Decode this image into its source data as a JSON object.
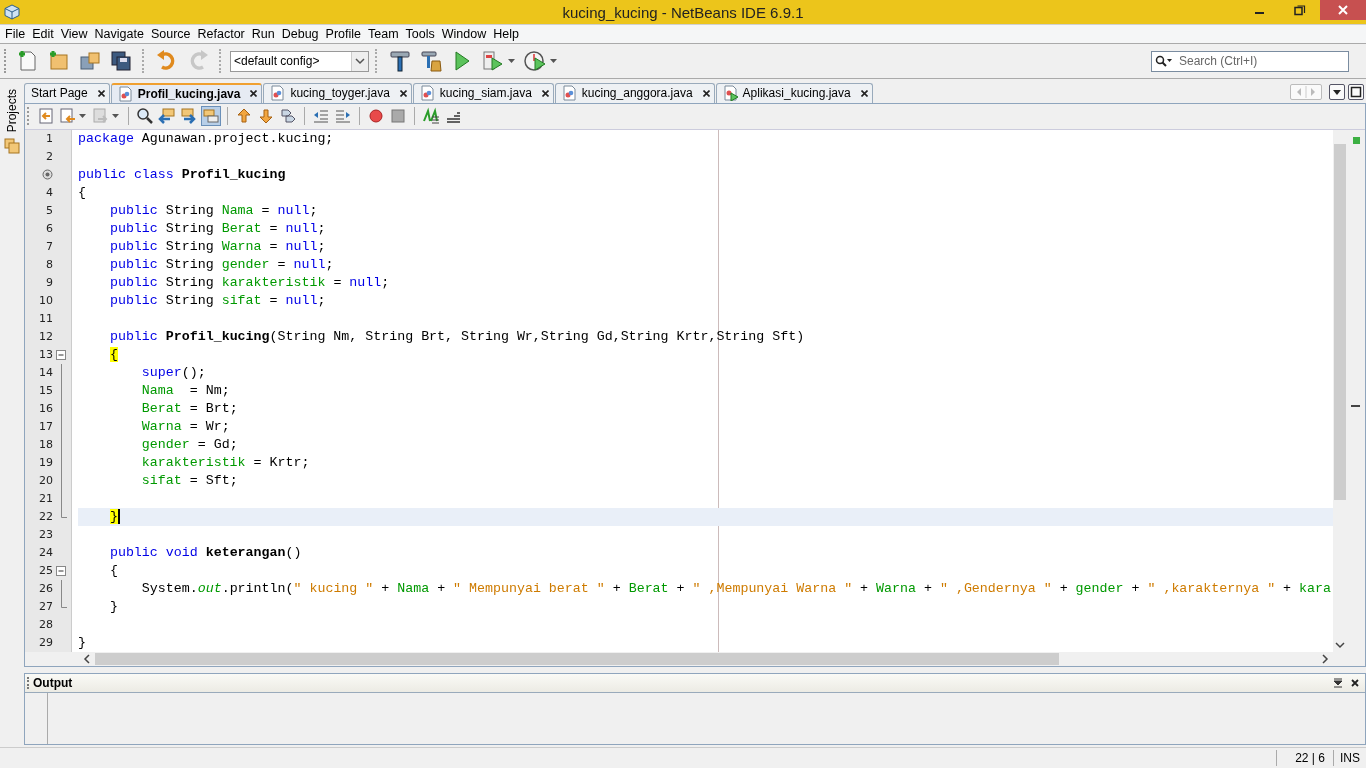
{
  "window": {
    "title": "kucing_kucing - NetBeans IDE 6.9.1"
  },
  "menu": [
    "File",
    "Edit",
    "View",
    "Navigate",
    "Source",
    "Refactor",
    "Run",
    "Debug",
    "Profile",
    "Team",
    "Tools",
    "Window",
    "Help"
  ],
  "toolbar": [
    {
      "kind": "new-file",
      "disabled": false
    },
    {
      "kind": "new-project",
      "disabled": false
    },
    {
      "kind": "open-project",
      "disabled": false
    },
    {
      "kind": "save-all",
      "disabled": false
    },
    {
      "kind": "undo",
      "disabled": false
    },
    {
      "kind": "redo",
      "disabled": true
    },
    {
      "kind": "config",
      "value": "<default config>"
    },
    {
      "kind": "build",
      "disabled": false
    },
    {
      "kind": "clean-build",
      "disabled": false
    },
    {
      "kind": "run",
      "disabled": false
    },
    {
      "kind": "debug",
      "disabled": false
    },
    {
      "kind": "profile",
      "disabled": false
    }
  ],
  "search": {
    "placeholder": "Search (Ctrl+I)"
  },
  "side_tabs": [
    {
      "label": "Projects"
    }
  ],
  "editor_tabs": [
    {
      "label": "Start Page",
      "kind": "page",
      "selected": false
    },
    {
      "label": "Profil_kucing.java",
      "kind": "java",
      "selected": true
    },
    {
      "label": "kucing_toyger.java",
      "kind": "java",
      "selected": false
    },
    {
      "label": "kucing_siam.java",
      "kind": "java",
      "selected": false
    },
    {
      "label": "kucing_anggora.java",
      "kind": "java",
      "selected": false
    },
    {
      "label": "Aplikasi_kucing.java",
      "kind": "main",
      "selected": false
    }
  ],
  "editor_toolbar": [
    {
      "kind": "last-edit",
      "on": false
    },
    {
      "kind": "back",
      "on": false
    },
    {
      "kind": "forward",
      "on": false
    },
    {
      "kind": "find",
      "on": false
    },
    {
      "kind": "find-prev",
      "on": false
    },
    {
      "kind": "find-next",
      "on": false
    },
    {
      "kind": "highlight",
      "on": true
    },
    {
      "kind": "prev-bookmark",
      "on": false
    },
    {
      "kind": "next-bookmark",
      "on": false
    },
    {
      "kind": "toggle-bookmark",
      "on": false
    },
    {
      "kind": "shift-left",
      "on": false
    },
    {
      "kind": "shift-right",
      "on": false
    },
    {
      "kind": "record",
      "on": false
    },
    {
      "kind": "stop",
      "on": false
    },
    {
      "kind": "comment",
      "on": false
    },
    {
      "kind": "uncomment",
      "on": false
    }
  ],
  "editor": {
    "lines": [
      {
        "kind": "numbered",
        "number": "1",
        "tokens": [
          {
            "kind": "keyword",
            "text": "package"
          },
          {
            "kind": "plain",
            "text": " Agunawan.project.kucing;"
          }
        ]
      },
      {
        "kind": "numbered",
        "number": "2"
      },
      {
        "kind": "class-marker",
        "tokens": [
          {
            "kind": "keyword",
            "text": "public"
          },
          {
            "kind": "keyword",
            "text": " class"
          },
          {
            "kind": "declaration",
            "text": " Profil_kucing"
          }
        ]
      },
      {
        "kind": "numbered",
        "number": "4",
        "tokens": [
          {
            "kind": "plain",
            "text": "{"
          }
        ]
      },
      {
        "kind": "numbered",
        "number": "5",
        "tokens": [
          {
            "kind": "keyword",
            "text": "    public"
          },
          {
            "kind": "plain",
            "text": " String "
          },
          {
            "kind": "field",
            "text": "Nama"
          },
          {
            "kind": "plain",
            "text": " = "
          },
          {
            "kind": "keyword",
            "text": "null"
          },
          {
            "kind": "plain",
            "text": ";"
          }
        ]
      },
      {
        "kind": "numbered",
        "number": "6",
        "tokens": [
          {
            "kind": "keyword",
            "text": "    public"
          },
          {
            "kind": "plain",
            "text": " String "
          },
          {
            "kind": "field",
            "text": "Berat"
          },
          {
            "kind": "plain",
            "text": " = "
          },
          {
            "kind": "keyword",
            "text": "null"
          },
          {
            "kind": "plain",
            "text": ";"
          }
        ]
      },
      {
        "kind": "numbered",
        "number": "7",
        "tokens": [
          {
            "kind": "keyword",
            "text": "    public"
          },
          {
            "kind": "plain",
            "text": " String "
          },
          {
            "kind": "field",
            "text": "Warna"
          },
          {
            "kind": "plain",
            "text": " = "
          },
          {
            "kind": "keyword",
            "text": "null"
          },
          {
            "kind": "plain",
            "text": ";"
          }
        ]
      },
      {
        "kind": "numbered",
        "number": "8",
        "tokens": [
          {
            "kind": "keyword",
            "text": "    public"
          },
          {
            "kind": "plain",
            "text": " String "
          },
          {
            "kind": "field",
            "text": "gender"
          },
          {
            "kind": "plain",
            "text": " = "
          },
          {
            "kind": "keyword",
            "text": "null"
          },
          {
            "kind": "plain",
            "text": ";"
          }
        ]
      },
      {
        "kind": "numbered",
        "number": "9",
        "tokens": [
          {
            "kind": "keyword",
            "text": "    public"
          },
          {
            "kind": "plain",
            "text": " String "
          },
          {
            "kind": "field",
            "text": "karakteristik"
          },
          {
            "kind": "plain",
            "text": " = "
          },
          {
            "kind": "keyword",
            "text": "null"
          },
          {
            "kind": "plain",
            "text": ";"
          }
        ]
      },
      {
        "kind": "numbered",
        "number": "10",
        "tokens": [
          {
            "kind": "keyword",
            "text": "    public"
          },
          {
            "kind": "plain",
            "text": " String "
          },
          {
            "kind": "field",
            "text": "sifat"
          },
          {
            "kind": "plain",
            "text": " = "
          },
          {
            "kind": "keyword",
            "text": "null"
          },
          {
            "kind": "plain",
            "text": ";"
          }
        ]
      },
      {
        "kind": "numbered",
        "number": "11"
      },
      {
        "kind": "numbered",
        "number": "12",
        "tokens": [
          {
            "kind": "keyword",
            "text": "    public"
          },
          {
            "kind": "declaration",
            "text": " Profil_kucing"
          },
          {
            "kind": "plain",
            "text": "(String Nm, String Brt, String Wr,String Gd,String Krtr,String Sft)"
          }
        ]
      },
      {
        "kind": "numbered",
        "number": "13",
        "fold_start": true,
        "tokens": [
          {
            "kind": "match",
            "text": "    {"
          }
        ]
      },
      {
        "kind": "numbered",
        "number": "14",
        "tokens": [
          {
            "kind": "keyword",
            "text": "        super"
          },
          {
            "kind": "plain",
            "text": "();"
          }
        ]
      },
      {
        "kind": "numbered",
        "number": "15",
        "tokens": [
          {
            "kind": "field",
            "text": "        Nama"
          },
          {
            "kind": "plain",
            "text": "  = Nm;"
          }
        ]
      },
      {
        "kind": "numbered",
        "number": "16",
        "tokens": [
          {
            "kind": "field",
            "text": "        Berat"
          },
          {
            "kind": "plain",
            "text": " = Brt;"
          }
        ]
      },
      {
        "kind": "numbered",
        "number": "17",
        "tokens": [
          {
            "kind": "field",
            "text": "        Warna"
          },
          {
            "kind": "plain",
            "text": " = Wr;"
          }
        ]
      },
      {
        "kind": "numbered",
        "number": "18",
        "tokens": [
          {
            "kind": "field",
            "text": "        gender"
          },
          {
            "kind": "plain",
            "text": " = Gd;"
          }
        ]
      },
      {
        "kind": "numbered",
        "number": "19",
        "tokens": [
          {
            "kind": "field",
            "text": "        karakteristik"
          },
          {
            "kind": "plain",
            "text": " = Krtr;"
          }
        ]
      },
      {
        "kind": "numbered",
        "number": "20",
        "tokens": [
          {
            "kind": "field",
            "text": "        sifat"
          },
          {
            "kind": "plain",
            "text": " = Sft;"
          }
        ]
      },
      {
        "kind": "numbered",
        "number": "21"
      },
      {
        "kind": "numbered",
        "number": "22",
        "fold_end": true,
        "current": true,
        "tokens": [
          {
            "kind": "match",
            "text": "    }"
          }
        ]
      },
      {
        "kind": "numbered",
        "number": "23"
      },
      {
        "kind": "numbered",
        "number": "24",
        "tokens": [
          {
            "kind": "keyword",
            "text": "    public"
          },
          {
            "kind": "keyword",
            "text": " void"
          },
          {
            "kind": "declaration",
            "text": " keterangan"
          },
          {
            "kind": "plain",
            "text": "()"
          }
        ]
      },
      {
        "kind": "numbered",
        "number": "25",
        "fold_start": true,
        "tokens": [
          {
            "kind": "plain",
            "text": "    {"
          }
        ]
      },
      {
        "kind": "numbered",
        "number": "26",
        "tokens": [
          {
            "kind": "plain",
            "text": "        System."
          },
          {
            "kind": "static",
            "text": "out"
          },
          {
            "kind": "plain",
            "text": ".println("
          },
          {
            "kind": "string",
            "text": "\" kucing \""
          },
          {
            "kind": "plain",
            "text": " + "
          },
          {
            "kind": "field",
            "text": "Nama"
          },
          {
            "kind": "plain",
            "text": " + "
          },
          {
            "kind": "string",
            "text": "\" Mempunyai berat \""
          },
          {
            "kind": "plain",
            "text": " + "
          },
          {
            "kind": "field",
            "text": "Berat"
          },
          {
            "kind": "plain",
            "text": " + "
          },
          {
            "kind": "string",
            "text": "\" ,Mempunyai Warna \""
          },
          {
            "kind": "plain",
            "text": " + "
          },
          {
            "kind": "field",
            "text": "Warna"
          },
          {
            "kind": "plain",
            "text": " + "
          },
          {
            "kind": "string",
            "text": "\" ,Gendernya \""
          },
          {
            "kind": "plain",
            "text": " + "
          },
          {
            "kind": "field",
            "text": "gender"
          },
          {
            "kind": "plain",
            "text": " + "
          },
          {
            "kind": "string",
            "text": "\" ,karakternya \""
          },
          {
            "kind": "plain",
            "text": " + "
          },
          {
            "kind": "field",
            "text": "kara"
          }
        ]
      },
      {
        "kind": "numbered",
        "number": "27",
        "fold_end": true,
        "tokens": [
          {
            "kind": "plain",
            "text": "    }"
          }
        ]
      },
      {
        "kind": "numbered",
        "number": "28"
      },
      {
        "kind": "numbered",
        "number": "29",
        "tokens": [
          {
            "kind": "plain",
            "text": "}"
          }
        ]
      }
    ]
  },
  "output": {
    "title": "Output"
  },
  "status_bar": {
    "position": "22 | 6",
    "mode": "INS"
  }
}
